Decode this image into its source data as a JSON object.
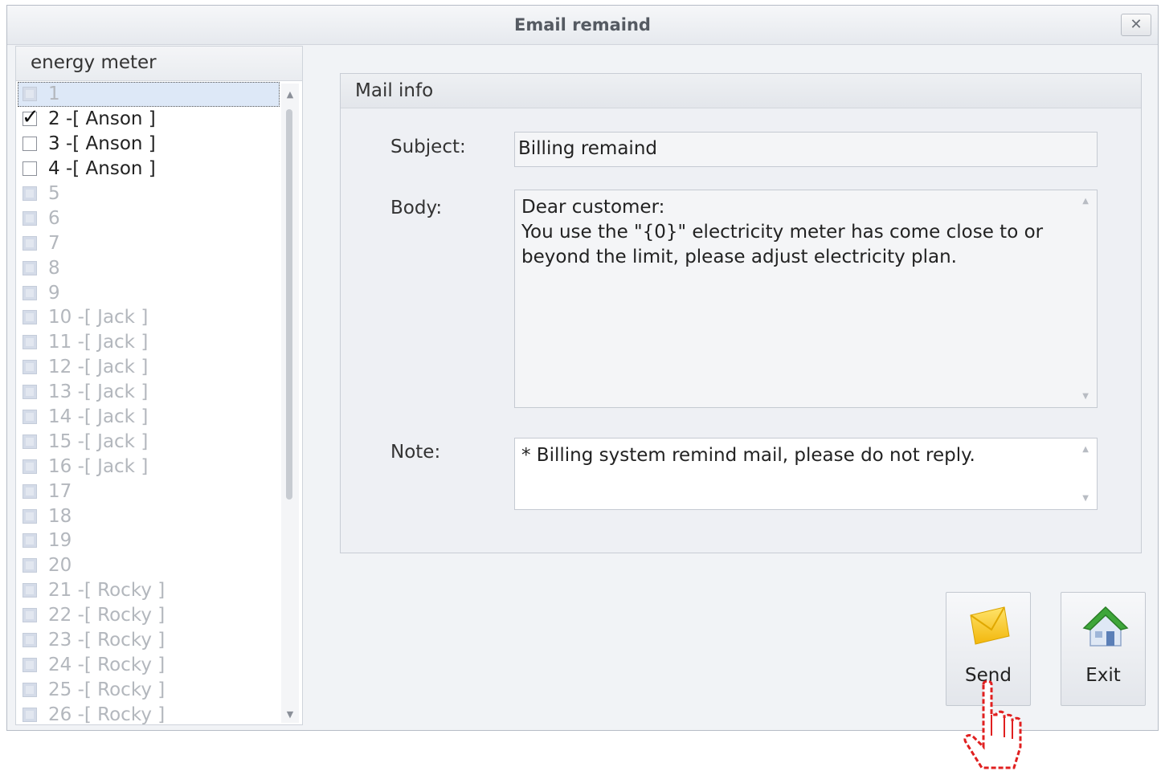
{
  "window": {
    "title": "Email remaind",
    "close_label": "✕"
  },
  "left_panel": {
    "header": "energy meter",
    "items": [
      {
        "label": "1",
        "enabled": false,
        "checked": false,
        "selected": true
      },
      {
        "label": "2 -[ Anson ]",
        "enabled": true,
        "checked": true,
        "selected": false
      },
      {
        "label": "3 -[ Anson ]",
        "enabled": true,
        "checked": false,
        "selected": false
      },
      {
        "label": "4 -[ Anson ]",
        "enabled": true,
        "checked": false,
        "selected": false
      },
      {
        "label": "5",
        "enabled": false,
        "checked": false,
        "selected": false
      },
      {
        "label": "6",
        "enabled": false,
        "checked": false,
        "selected": false
      },
      {
        "label": "7",
        "enabled": false,
        "checked": false,
        "selected": false
      },
      {
        "label": "8",
        "enabled": false,
        "checked": false,
        "selected": false
      },
      {
        "label": "9",
        "enabled": false,
        "checked": false,
        "selected": false
      },
      {
        "label": "10 -[ Jack ]",
        "enabled": false,
        "checked": false,
        "selected": false
      },
      {
        "label": "11 -[ Jack ]",
        "enabled": false,
        "checked": false,
        "selected": false
      },
      {
        "label": "12 -[ Jack ]",
        "enabled": false,
        "checked": false,
        "selected": false
      },
      {
        "label": "13 -[ Jack ]",
        "enabled": false,
        "checked": false,
        "selected": false
      },
      {
        "label": "14 -[ Jack ]",
        "enabled": false,
        "checked": false,
        "selected": false
      },
      {
        "label": "15 -[ Jack ]",
        "enabled": false,
        "checked": false,
        "selected": false
      },
      {
        "label": "16 -[ Jack ]",
        "enabled": false,
        "checked": false,
        "selected": false
      },
      {
        "label": "17",
        "enabled": false,
        "checked": false,
        "selected": false
      },
      {
        "label": "18",
        "enabled": false,
        "checked": false,
        "selected": false
      },
      {
        "label": "19",
        "enabled": false,
        "checked": false,
        "selected": false
      },
      {
        "label": "20",
        "enabled": false,
        "checked": false,
        "selected": false
      },
      {
        "label": "21 -[ Rocky ]",
        "enabled": false,
        "checked": false,
        "selected": false
      },
      {
        "label": "22 -[ Rocky ]",
        "enabled": false,
        "checked": false,
        "selected": false
      },
      {
        "label": "23 -[ Rocky ]",
        "enabled": false,
        "checked": false,
        "selected": false
      },
      {
        "label": "24 -[ Rocky ]",
        "enabled": false,
        "checked": false,
        "selected": false
      },
      {
        "label": "25 -[ Rocky ]",
        "enabled": false,
        "checked": false,
        "selected": false
      },
      {
        "label": "26 -[ Rocky ]",
        "enabled": false,
        "checked": false,
        "selected": false
      }
    ]
  },
  "mail_info": {
    "header": "Mail info",
    "subject_label": "Subject:",
    "subject_value": "Billing remaind",
    "body_label": "Body:",
    "body_value": "Dear customer:\nYou use the \"{0}\" electricity meter has come close to or beyond the limit, please adjust electricity plan.",
    "note_label": "Note:",
    "note_value": "* Billing system remind mail, please do not reply."
  },
  "buttons": {
    "send_label": "Send",
    "exit_label": "Exit"
  },
  "icons": {
    "send": "envelope-icon",
    "exit": "house-icon",
    "cursor": "pointing-hand-cursor-icon",
    "close": "close-icon"
  },
  "colors": {
    "send_icon": "#f2c21b",
    "exit_roof": "#3ea63a",
    "cursor_outline": "#e02020"
  }
}
